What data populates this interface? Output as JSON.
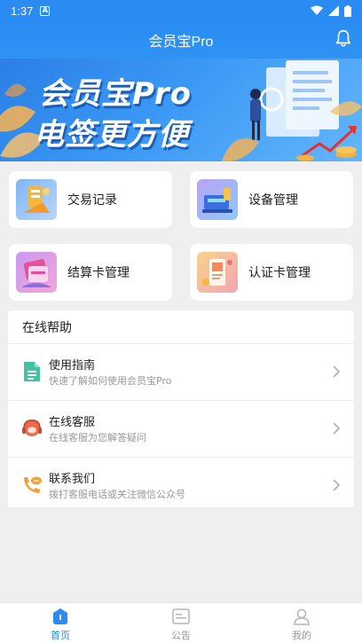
{
  "status": {
    "time": "1:37",
    "notif_letter": "A"
  },
  "header": {
    "title": "会员宝Pro"
  },
  "banner": {
    "line1": "会员宝Pro",
    "line2": "电签更方便"
  },
  "grid": [
    {
      "label": "交易记录"
    },
    {
      "label": "设备管理"
    },
    {
      "label": "结算卡管理"
    },
    {
      "label": "认证卡管理"
    }
  ],
  "help": {
    "title": "在线帮助",
    "items": [
      {
        "title": "使用指南",
        "subtitle": "快速了解如何使用会员宝Pro"
      },
      {
        "title": "在线客服",
        "subtitle": "在线客服为您解答疑问"
      },
      {
        "title": "联系我们",
        "subtitle": "拨打客服电话或关注微信公众号"
      }
    ]
  },
  "tabs": [
    {
      "label": "首页"
    },
    {
      "label": "公告"
    },
    {
      "label": "我的"
    }
  ],
  "colors": {
    "primary": "#2a8cf3",
    "background": "#efefef"
  }
}
